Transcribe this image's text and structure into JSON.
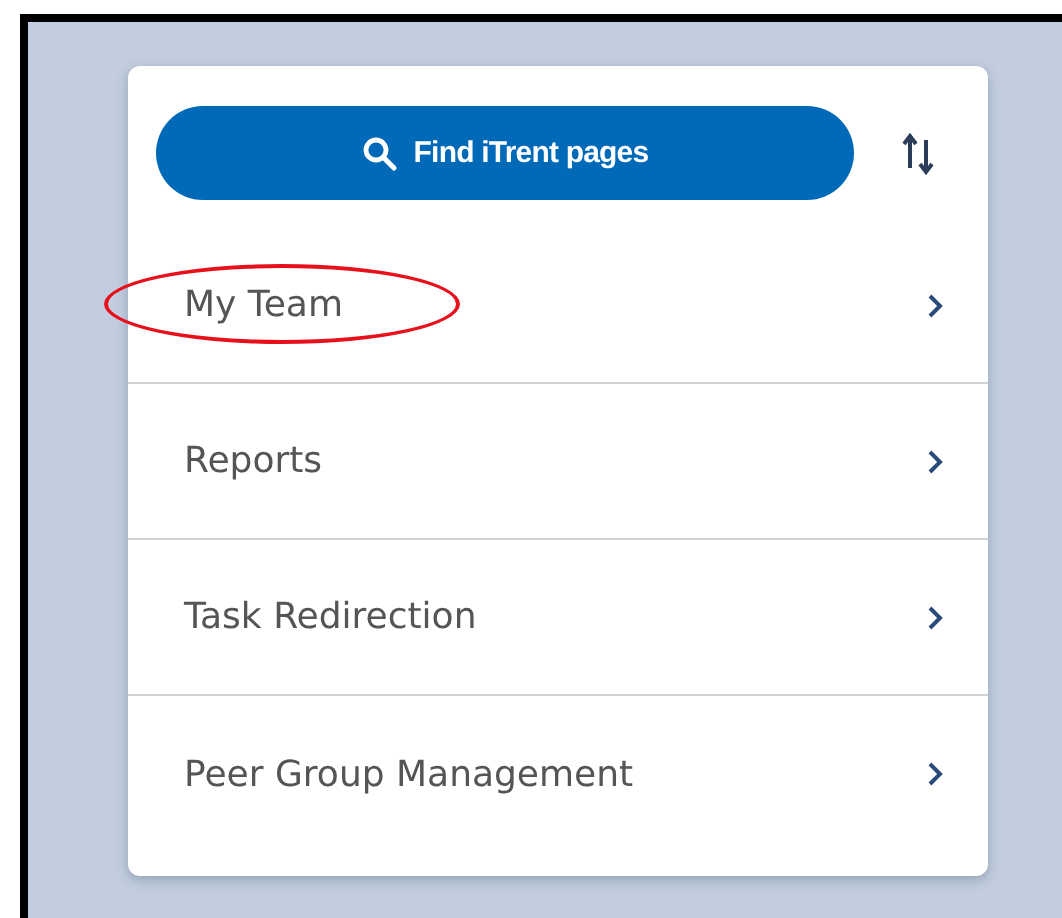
{
  "search_button": {
    "label": "Find iTrent pages"
  },
  "menu_items": [
    {
      "label": "My Team",
      "highlighted": true
    },
    {
      "label": "Reports",
      "highlighted": false
    },
    {
      "label": "Task Redirection",
      "highlighted": false
    },
    {
      "label": "Peer Group Management",
      "highlighted": false
    }
  ]
}
